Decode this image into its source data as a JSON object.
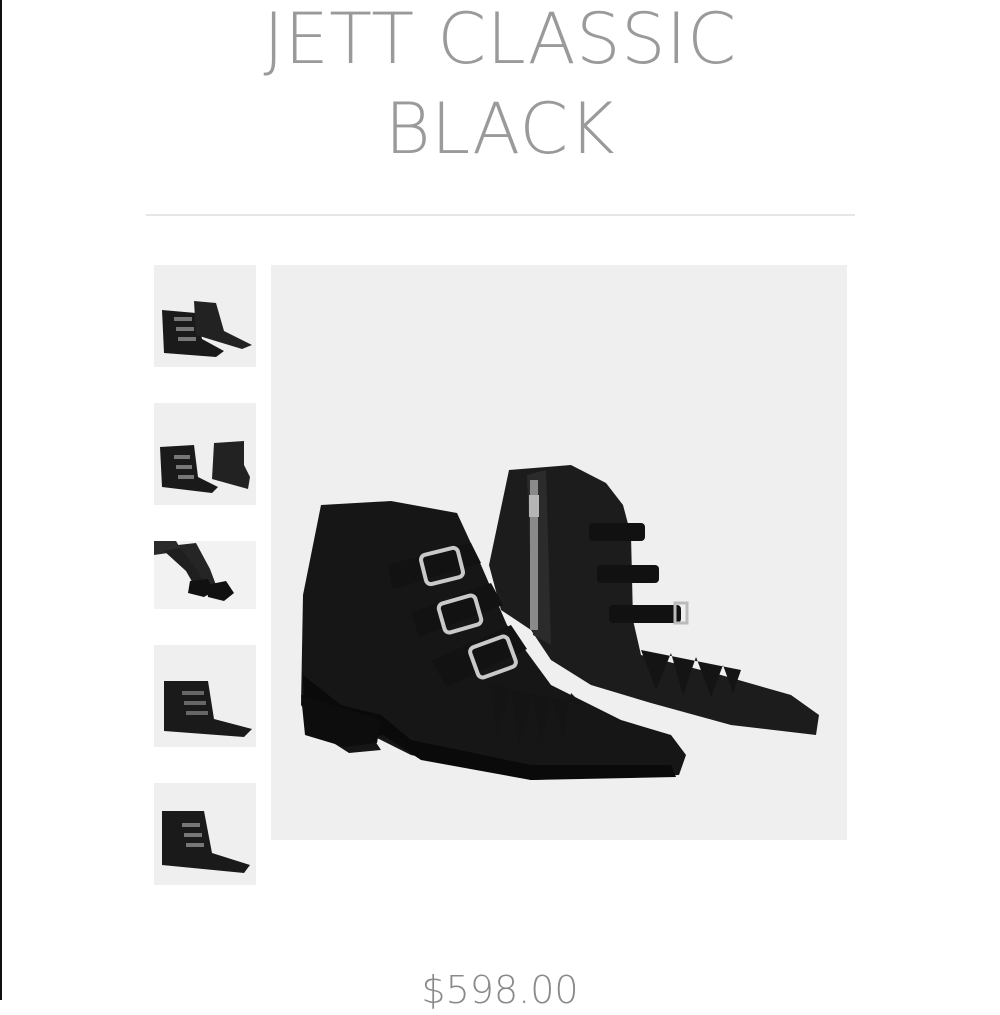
{
  "product": {
    "title_line1": "JETT CLASSIC",
    "title_line2": "BLACK",
    "price": "$598.00"
  },
  "gallery": {
    "thumbnails": [
      {
        "name": "thumb-pair-side"
      },
      {
        "name": "thumb-pair-angle"
      },
      {
        "name": "thumb-worn"
      },
      {
        "name": "thumb-single-side"
      },
      {
        "name": "thumb-single-front"
      }
    ],
    "main_image": "main-image-boots-pair"
  },
  "colors": {
    "title": "#9a9a9a",
    "image_bg": "#efefef",
    "boot": "#1a1a1a"
  }
}
